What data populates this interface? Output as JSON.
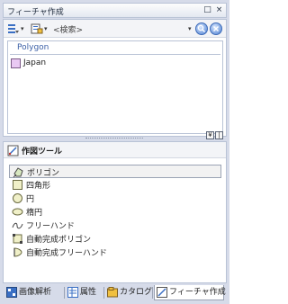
{
  "window": {
    "title": "フィーチャ作成",
    "close_glyph": "×",
    "pin_glyph": "□"
  },
  "toolbar": {
    "search_placeholder": "<検索>"
  },
  "templates": {
    "group_name": "Polygon",
    "items": [
      {
        "label": "Japan",
        "fill_color": "#e9c9f3"
      }
    ]
  },
  "construction": {
    "title": "作図ツール",
    "tools": [
      {
        "label": "ポリゴン",
        "icon": "polygon-icon",
        "selected": true
      },
      {
        "label": "四角形",
        "icon": "rectangle-icon",
        "selected": false
      },
      {
        "label": "円",
        "icon": "circle-icon",
        "selected": false
      },
      {
        "label": "楕円",
        "icon": "ellipse-icon",
        "selected": false
      },
      {
        "label": "フリーハンド",
        "icon": "freehand-icon",
        "selected": false
      },
      {
        "label": "自動完成ポリゴン",
        "icon": "auto-complete-polygon-icon",
        "selected": false
      },
      {
        "label": "自動完成フリーハンド",
        "icon": "auto-complete-freehand-icon",
        "selected": false
      }
    ]
  },
  "tabs": [
    {
      "label": "画像解析",
      "active": false
    },
    {
      "label": "属性",
      "active": false
    },
    {
      "label": "カタログ",
      "active": false
    },
    {
      "label": "フィーチャ作成",
      "active": true
    }
  ],
  "colors": {
    "accent": "#3b5fa6",
    "frame": "#d6dbe9",
    "template_fill": "#e9c9f3"
  }
}
